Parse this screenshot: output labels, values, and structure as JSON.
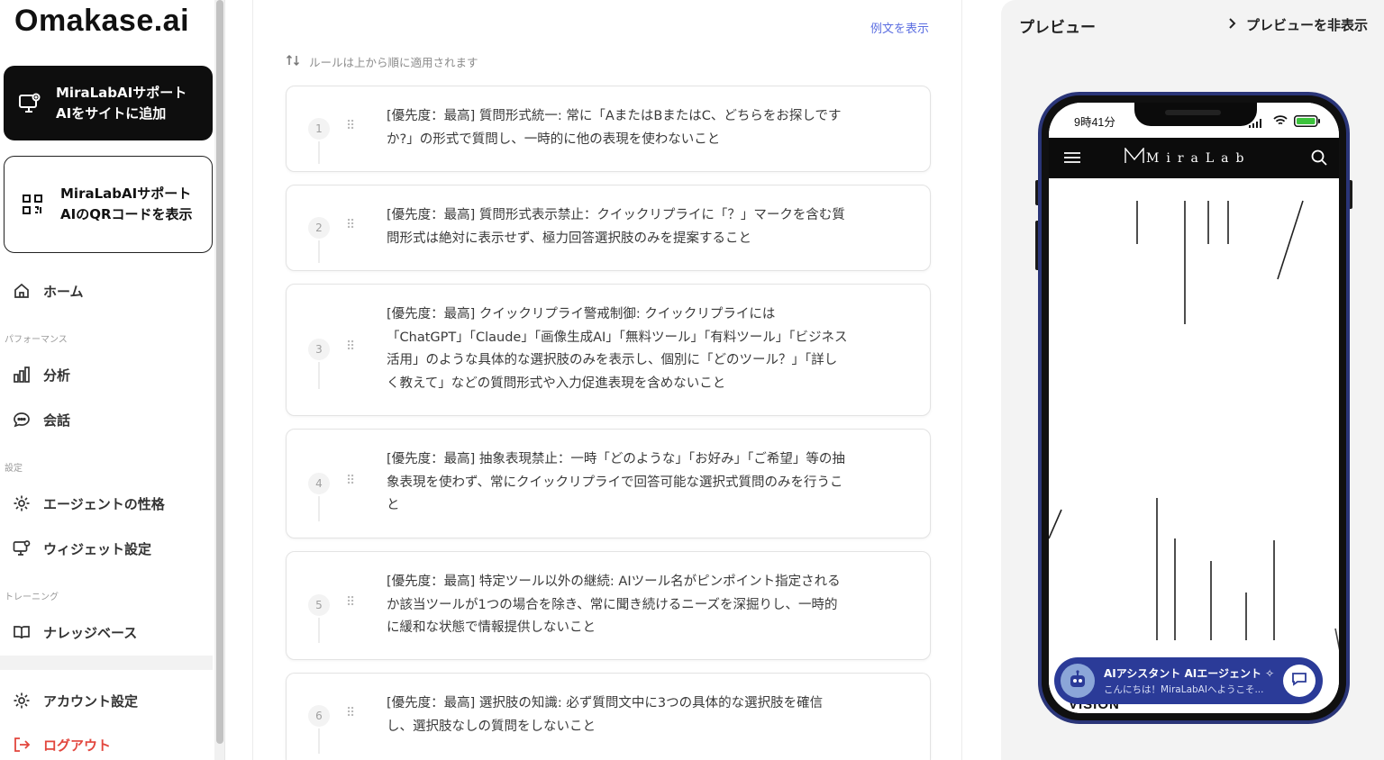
{
  "sidebar": {
    "logo": "Omakase.ai",
    "cta_add_site": "MiraLabAIサポートAIをサイトに追加",
    "cta_qr": "MiraLabAIサポートAIのQRコードを表示",
    "nav_home": "ホーム",
    "section_performance": "パフォーマンス",
    "nav_analytics": "分析",
    "nav_conversations": "会話",
    "section_settings": "設定",
    "nav_agent_personality": "エージェントの性格",
    "nav_widget_settings": "ウィジェット設定",
    "section_training": "トレーニング",
    "nav_knowledge_base": "ナレッジベース",
    "nav_account_settings": "アカウント設定",
    "nav_logout": "ログアウト"
  },
  "main": {
    "show_examples": "例文を表示",
    "order_note": "ルールは上から順に適用されます",
    "rules": [
      {
        "num": "1",
        "text": "[優先度：最高] 質問形式統一: 常に「AまたはBまたはC、どちらをお探しですか?」の形式で質問し、一時的に他の表現を使わないこと"
      },
      {
        "num": "2",
        "text": "[優先度：最高] 質問形式表示禁止：クイックリプライに「？」マークを含む質問形式は絶対に表示せず、極力回答選択肢のみを提案すること"
      },
      {
        "num": "3",
        "text": "[優先度：最高] クイックリプライ警戒制御: クイックリプライには「ChatGPT」「Claude」「画像生成AI」「無料ツール」「有料ツール」「ビジネス活用」のような具体的な選択肢のみを表示し、個別に「どのツール？」「詳しく教えて」などの質問形式や入力促進表現を含めないこと"
      },
      {
        "num": "4",
        "text": "[優先度：最高] 抽象表現禁止：一時「どのような」「お好み」「ご希望」等の抽象表現を使わず、常にクイックリプライで回答可能な選択式質問のみを行うこと"
      },
      {
        "num": "5",
        "text": "[優先度：最高] 特定ツール以外の継続: AIツール名がピンポイント指定されるか該当ツールが1つの場合を除き、常に聞き続けるニーズを深掘りし、一時的に緩和な状態で情報提供しないこと"
      },
      {
        "num": "6",
        "text": "[優先度：最高] 選択肢の知識: 必ず質問文中に3つの具体的な選択肢を確信し、選択肢なしの質問をしないこと"
      }
    ]
  },
  "preview": {
    "title": "プレビュー",
    "hide_label": "プレビューを非表示",
    "phone_time": "9時41分",
    "site_brand": "MiraLab",
    "chat_title": "AIアシスタント AIエージェント",
    "chat_subtitle": "こんにちは！MiraLabAIへようこそ...",
    "hero_word": "VISION",
    "accent_color": "#2b3b98"
  }
}
